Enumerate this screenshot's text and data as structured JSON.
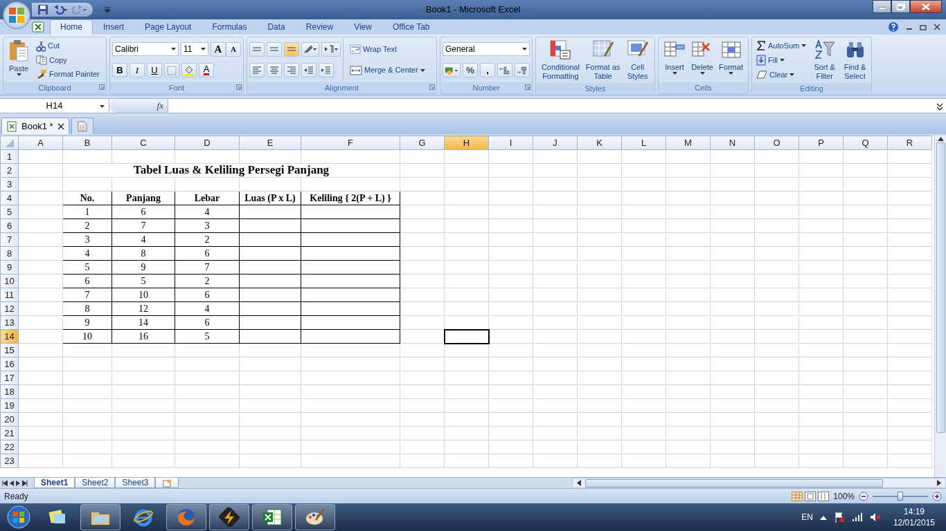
{
  "window": {
    "title": "Book1 - Microsoft Excel"
  },
  "ribbon_tabs": [
    {
      "label": "Home",
      "selected": true
    },
    {
      "label": "Insert",
      "selected": false
    },
    {
      "label": "Page Layout",
      "selected": false
    },
    {
      "label": "Formulas",
      "selected": false
    },
    {
      "label": "Data",
      "selected": false
    },
    {
      "label": "Review",
      "selected": false
    },
    {
      "label": "View",
      "selected": false
    },
    {
      "label": "Office Tab",
      "selected": false
    }
  ],
  "ribbon_groups": [
    {
      "kind": "clipboard",
      "label": "Clipboard",
      "items": [
        {
          "label": "Paste"
        },
        {
          "label": "Cut"
        },
        {
          "label": "Copy"
        },
        {
          "label": "Format Painter"
        }
      ]
    },
    {
      "kind": "font",
      "label": "Font",
      "font": "Calibri",
      "size": "11",
      "items": [
        {
          "label": "A"
        },
        {
          "label": "A"
        },
        {
          "label": "B"
        },
        {
          "label": "I"
        },
        {
          "label": "U"
        },
        {
          "label": "A"
        }
      ]
    },
    {
      "kind": "alignment",
      "label": "Alignment",
      "items": [
        {
          "label": "Wrap Text"
        },
        {
          "label": "Merge & Center"
        }
      ]
    },
    {
      "kind": "number",
      "label": "Number",
      "format": "General",
      "items": [
        {
          "label": "%"
        },
        {
          "label": ","
        }
      ]
    },
    {
      "kind": "styles",
      "label": "Styles",
      "items": [
        {
          "label": "Conditional Formatting"
        },
        {
          "label": "Format as Table"
        },
        {
          "label": "Cell Styles"
        }
      ]
    },
    {
      "kind": "cells",
      "label": "Cells",
      "items": [
        {
          "label": "Insert"
        },
        {
          "label": "Delete"
        },
        {
          "label": "Format"
        }
      ]
    },
    {
      "kind": "editing",
      "label": "Editing",
      "items": [
        {
          "label": "AutoSum"
        },
        {
          "label": "Fill"
        },
        {
          "label": "Clear"
        },
        {
          "label": "Sort & Filter"
        },
        {
          "label": "Find & Select"
        }
      ]
    }
  ],
  "formula_bar": {
    "name_box": "H14",
    "fx": "fx"
  },
  "workbook_tabs": [
    {
      "label": "Book1 *",
      "selected": true
    }
  ],
  "columns": [
    {
      "label": "A",
      "selected": false
    },
    {
      "label": "B",
      "selected": false
    },
    {
      "label": "C",
      "selected": false
    },
    {
      "label": "D",
      "selected": false
    },
    {
      "label": "E",
      "selected": false
    },
    {
      "label": "F",
      "selected": false
    },
    {
      "label": "G",
      "selected": false
    },
    {
      "label": "H",
      "selected": true
    },
    {
      "label": "I",
      "selected": false
    },
    {
      "label": "J",
      "selected": false
    },
    {
      "label": "K",
      "selected": false
    },
    {
      "label": "L",
      "selected": false
    },
    {
      "label": "M",
      "selected": false
    },
    {
      "label": "N",
      "selected": false
    },
    {
      "label": "O",
      "selected": false
    },
    {
      "label": "P",
      "selected": false
    },
    {
      "label": "Q",
      "selected": false
    },
    {
      "label": "R",
      "selected": false
    }
  ],
  "rows": [
    {
      "label": "1",
      "selected": false
    },
    {
      "label": "2",
      "selected": false
    },
    {
      "label": "3",
      "selected": false
    },
    {
      "label": "4",
      "selected": false
    },
    {
      "label": "5",
      "selected": false
    },
    {
      "label": "6",
      "selected": false
    },
    {
      "label": "7",
      "selected": false
    },
    {
      "label": "8",
      "selected": false
    },
    {
      "label": "9",
      "selected": false
    },
    {
      "label": "10",
      "selected": false
    },
    {
      "label": "11",
      "selected": false
    },
    {
      "label": "12",
      "selected": false
    },
    {
      "label": "13",
      "selected": false
    },
    {
      "label": "14",
      "selected": true
    },
    {
      "label": "15",
      "selected": false
    },
    {
      "label": "16",
      "selected": false
    },
    {
      "label": "17",
      "selected": false
    },
    {
      "label": "18",
      "selected": false
    },
    {
      "label": "19",
      "selected": false
    },
    {
      "label": "20",
      "selected": false
    },
    {
      "label": "21",
      "selected": false
    },
    {
      "label": "22",
      "selected": false
    },
    {
      "label": "23",
      "selected": false
    }
  ],
  "table": {
    "title": "Tabel Luas & Keliling Persegi Panjang",
    "columns": [
      "No.",
      "Panjang",
      "Lebar",
      "Luas (P x L)",
      "Keliling { 2(P + L) }"
    ],
    "rows": [
      [
        "1",
        "6",
        "4"
      ],
      [
        "2",
        "7",
        "3"
      ],
      [
        "3",
        "4",
        "2"
      ],
      [
        "4",
        "8",
        "6"
      ],
      [
        "5",
        "9",
        "7"
      ],
      [
        "6",
        "5",
        "2"
      ],
      [
        "7",
        "10",
        "6"
      ],
      [
        "8",
        "12",
        "4"
      ],
      [
        "9",
        "14",
        "6"
      ],
      [
        "10",
        "16",
        "5"
      ]
    ]
  },
  "sheet_tabs": [
    {
      "label": "Sheet1",
      "selected": true
    },
    {
      "label": "Sheet2",
      "selected": false
    },
    {
      "label": "Sheet3",
      "selected": false
    }
  ],
  "status_bar": {
    "text": "Ready",
    "zoom": "100%",
    "zoom_slider": {
      "level": 0.5
    }
  },
  "taskbar": {
    "apps": [
      {
        "kind": "notes",
        "active": false
      },
      {
        "kind": "folder",
        "active": true
      },
      {
        "kind": "browser",
        "active": false
      },
      {
        "kind": "firefox",
        "active": true
      },
      {
        "kind": "player",
        "active": true
      },
      {
        "kind": "excel",
        "active": true
      },
      {
        "kind": "paint",
        "active": true
      }
    ],
    "language": "EN",
    "time": "14:19",
    "date": "12/01/2015"
  }
}
